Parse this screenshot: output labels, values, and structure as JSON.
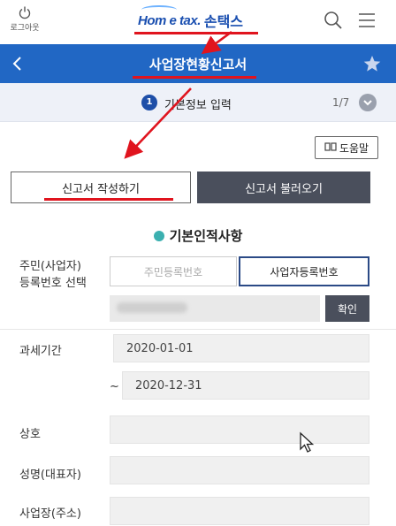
{
  "header": {
    "logout_label": "로그아웃",
    "logo_en": "Hom e tax.",
    "logo_ko": "손택스"
  },
  "titlebar": {
    "title": "사업장현황신고서"
  },
  "step": {
    "number": "1",
    "label": "기본정보 입력",
    "count": "1/7"
  },
  "actions": {
    "help_label": "도움말",
    "write_label": "신고서 작성하기",
    "load_label": "신고서 불러오기"
  },
  "section": {
    "title": "기본인적사항"
  },
  "form": {
    "id_type_label": "주민(사업자)\n등록번호 선택",
    "id_type_line1": "주민(사업자)",
    "id_type_line2": "등록번호 선택",
    "option_resident": "주민등록번호",
    "option_business": "사업자등록번호",
    "confirm_label": "확인",
    "period_label": "과세기간",
    "period_start": "2020-01-01",
    "period_tilde": "~",
    "period_end": "2020-12-31",
    "company_label": "상호",
    "rep_label": "성명(대표자)",
    "address_label": "사업장(주소)"
  },
  "colors": {
    "brand_blue": "#2167c4",
    "annotation_red": "#e0141e",
    "dark_button": "#4a4f5c"
  }
}
